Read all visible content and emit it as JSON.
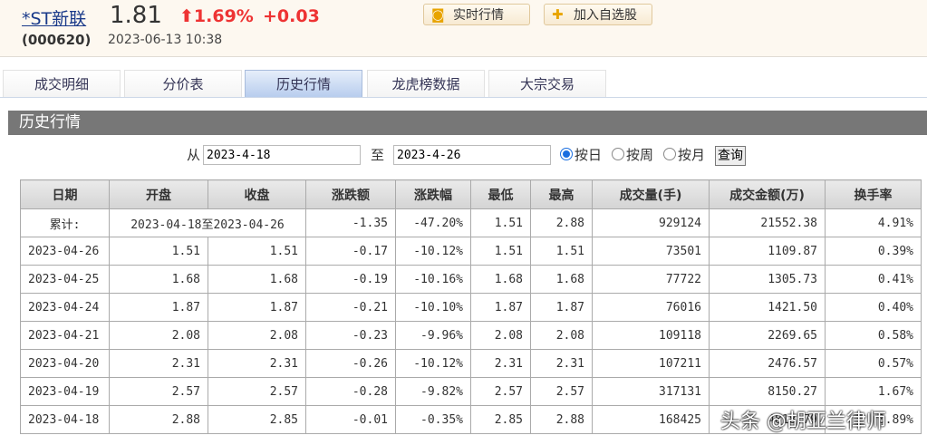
{
  "stock": {
    "name": "*ST新联",
    "code": "(000620)",
    "price": "1.81",
    "change_pct": "1.69%",
    "change": "+0.03",
    "time": "2023-06-13 10:38"
  },
  "buttons": {
    "realtime": "实时行情",
    "add_watch": "加入自选股"
  },
  "tabs": [
    "成交明细",
    "分价表",
    "历史行情",
    "龙虎榜数据",
    "大宗交易"
  ],
  "section_title": "历史行情",
  "filter": {
    "from_label": "从",
    "from": "2023-4-18",
    "to_label": "至",
    "to": "2023-4-26",
    "daily": "按日",
    "weekly": "按周",
    "monthly": "按月",
    "query": "查询"
  },
  "table": {
    "headers": [
      "日期",
      "开盘",
      "收盘",
      "涨跌额",
      "涨跌幅",
      "最低",
      "最高",
      "成交量(手)",
      "成交金额(万)",
      "换手率"
    ],
    "summary": {
      "label": "累计:",
      "range": "2023-04-18至2023-04-26",
      "chg": "-1.35",
      "pct": "-47.20%",
      "low": "1.51",
      "high": "2.88",
      "vol": "929124",
      "amt": "21552.38",
      "turn": "4.91%"
    },
    "rows": [
      [
        "2023-04-26",
        "1.51",
        "1.51",
        "-0.17",
        "-10.12%",
        "1.51",
        "1.51",
        "73501",
        "1109.87",
        "0.39%"
      ],
      [
        "2023-04-25",
        "1.68",
        "1.68",
        "-0.19",
        "-10.16%",
        "1.68",
        "1.68",
        "77722",
        "1305.73",
        "0.41%"
      ],
      [
        "2023-04-24",
        "1.87",
        "1.87",
        "-0.21",
        "-10.10%",
        "1.87",
        "1.87",
        "76016",
        "1421.50",
        "0.40%"
      ],
      [
        "2023-04-21",
        "2.08",
        "2.08",
        "-0.23",
        "-9.96%",
        "2.08",
        "2.08",
        "109118",
        "2269.65",
        "0.58%"
      ],
      [
        "2023-04-20",
        "2.31",
        "2.31",
        "-0.26",
        "-10.12%",
        "2.31",
        "2.31",
        "107211",
        "2476.57",
        "0.57%"
      ],
      [
        "2023-04-19",
        "2.57",
        "2.57",
        "-0.28",
        "-9.82%",
        "2.57",
        "2.57",
        "317131",
        "8150.27",
        "1.67%"
      ],
      [
        "2023-04-18",
        "2.88",
        "2.85",
        "-0.01",
        "-0.35%",
        "2.85",
        "2.88",
        "168425",
        "4818.79",
        "0.89%"
      ]
    ]
  },
  "watermark": "头条 @胡亚兰律师"
}
